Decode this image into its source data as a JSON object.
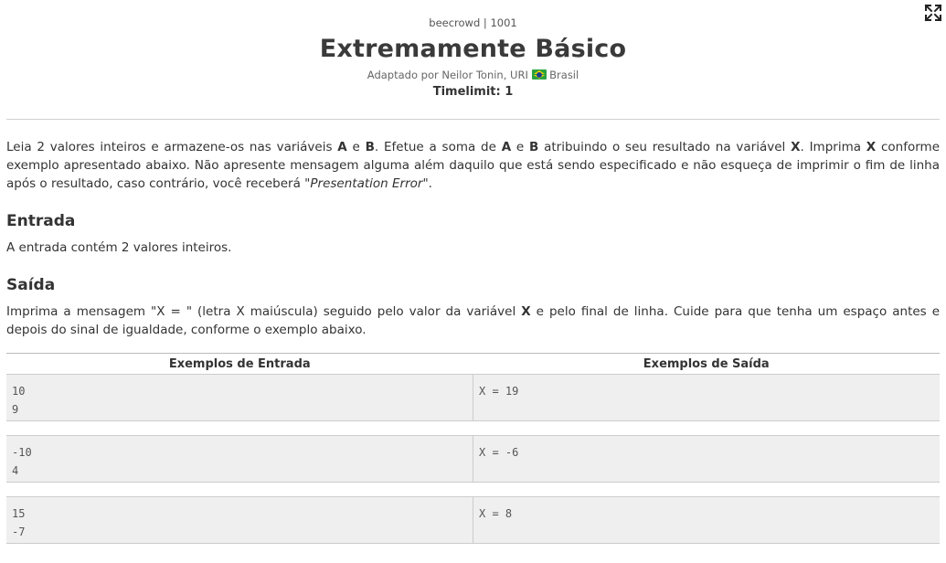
{
  "header": {
    "breadcrumb": "beecrowd | 1001",
    "title": "Extremamente Básico",
    "adapted_by": "Adaptado por Neilor Tonin, URI",
    "country": "Brasil",
    "timelimit": "Timelimit: 1"
  },
  "description": {
    "t1": "Leia 2 valores inteiros e armazene-os nas variáveis ",
    "b1": "A",
    "t2": " e ",
    "b2": "B",
    "t3": ". Efetue a soma de ",
    "b3": "A",
    "t4": " e ",
    "b4": "B",
    "t5": " atribuindo o seu resultado na variável ",
    "b5": "X",
    "t6": ". Imprima ",
    "b6": "X",
    "t7": " conforme exemplo apresentado abaixo. Não apresente mensagem alguma além daquilo que está sendo especificado e não esqueça de imprimir o fim de linha após o resultado, caso contrário, você receberá \"",
    "i1": "Presentation Error",
    "t8": "\"."
  },
  "input_section": {
    "heading": "Entrada",
    "text": "A entrada contém 2 valores inteiros."
  },
  "output_section": {
    "heading": "Saída",
    "t1": "Imprima a mensagem \"X = \" (letra X maiúscula) seguido pelo valor da variável ",
    "b1": "X",
    "t2": " e pelo final de linha. Cuide para que tenha um espaço antes e depois do sinal de igualdade, conforme o exemplo abaixo."
  },
  "examples": {
    "input_header": "Exemplos de Entrada",
    "output_header": "Exemplos de Saída",
    "rows": [
      {
        "in1": "10",
        "in2": "9",
        "out": "X = 19"
      },
      {
        "in1": "-10",
        "in2": "4",
        "out": "X = -6"
      },
      {
        "in1": "15",
        "in2": "-7",
        "out": "X = 8"
      }
    ]
  },
  "icons": {
    "expand": "expand-icon",
    "flag": "brazil-flag-icon"
  }
}
